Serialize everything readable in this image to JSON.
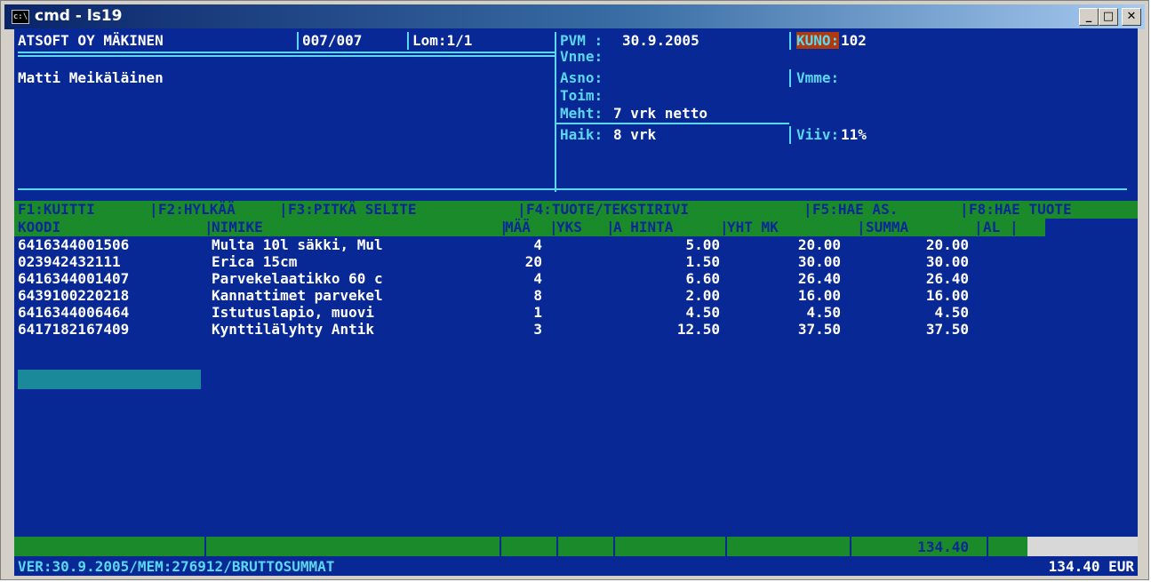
{
  "window": {
    "title": "cmd - ls19",
    "icon": "console-icon",
    "controls": [
      "minimize-icon",
      "maximize-icon",
      "close-icon"
    ]
  },
  "header": {
    "company": "ATSOFT OY MÄKINEN",
    "page": "007/007",
    "form": "Lom:1/1",
    "pvm_label": "PVM :",
    "pvm_value": "30.9.2005",
    "kuno_label": "KUNO:",
    "kuno_value": "102",
    "customer_name": "Matti Meikäläinen",
    "vnne_label": "Vnne:",
    "asno_label": "Asno:",
    "vmme_label": "Vmme:",
    "toim_label": "Toim:",
    "meht_label": "Meht:",
    "meht_value": "7 vrk netto",
    "haik_label": "Haik:",
    "haik_value": "8 vrk",
    "viiv_label": "Viiv:",
    "viiv_value": "11%"
  },
  "function_keys": {
    "f1": "F1:KUITTI",
    "f2": "F2:HYLKÄÄ",
    "f3": "F3:PITKÄ SELITE",
    "f4": "F4:TUOTE/TEKSTIRIVI",
    "f5": "F5:HAE AS.",
    "f8": "F8:HAE TUOTE"
  },
  "columns": {
    "koodi": "KOODI",
    "nimike": "NIMIKE",
    "maa": "MÄÄ",
    "yks": "YKS",
    "a_hinta": "A HINTA",
    "yht_mk": "YHT MK",
    "summa": "SUMMA",
    "al": "AL"
  },
  "rows": [
    {
      "koodi": "6416344001506",
      "nimike": "Multa 10l säkki, Mul",
      "maa": "4",
      "a_hinta": "5.00",
      "yht": "20.00",
      "summa": "20.00"
    },
    {
      "koodi": "023942432111",
      "nimike": "Erica 15cm",
      "maa": "20",
      "a_hinta": "1.50",
      "yht": "30.00",
      "summa": "30.00"
    },
    {
      "koodi": "6416344001407",
      "nimike": "Parvekelaatikko 60 c",
      "maa": "4",
      "a_hinta": "6.60",
      "yht": "26.40",
      "summa": "26.40"
    },
    {
      "koodi": "6439100220218",
      "nimike": "Kannattimet parvekel",
      "maa": "8",
      "a_hinta": "2.00",
      "yht": "16.00",
      "summa": "16.00"
    },
    {
      "koodi": "6416344006464",
      "nimike": "Istutuslapio, muovi",
      "maa": "1",
      "a_hinta": "4.50",
      "yht": "4.50",
      "summa": "4.50"
    },
    {
      "koodi": "6417182167409",
      "nimike": "Kynttilälyhty Antik",
      "maa": "3",
      "a_hinta": "12.50",
      "yht": "37.50",
      "summa": "37.50"
    }
  ],
  "footer": {
    "subtotal": "134.40",
    "status": "VER:30.9.2005/MEM:276912/BRUTTOSUMMAT",
    "total": "134.40 EUR"
  },
  "colors": {
    "console_bg": "#082896",
    "cyan": "#5ad8f0",
    "green_bar": "#1a8a2a",
    "kuno_bg": "#b03a10",
    "cursor_field": "#1a8a9a"
  }
}
